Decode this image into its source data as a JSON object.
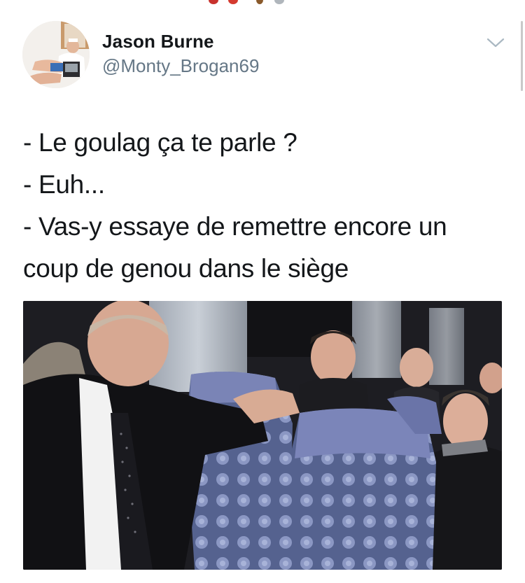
{
  "tweet": {
    "author_name": "Jason Burne",
    "author_handle": "@Monty_Brogan69",
    "text_lines": [
      "- Le goulag ça te parle ?",
      "- Euh...",
      "- Vas-y essaye de remettre encore un",
      "coup de genou dans le siège"
    ]
  },
  "icons": {
    "menu": "chevron-down-icon",
    "avatar": "avatar"
  },
  "colors": {
    "text_primary": "#14171a",
    "text_secondary": "#657786",
    "chevron": "#aab8c2",
    "seat_blue": "#6f7bb8"
  }
}
